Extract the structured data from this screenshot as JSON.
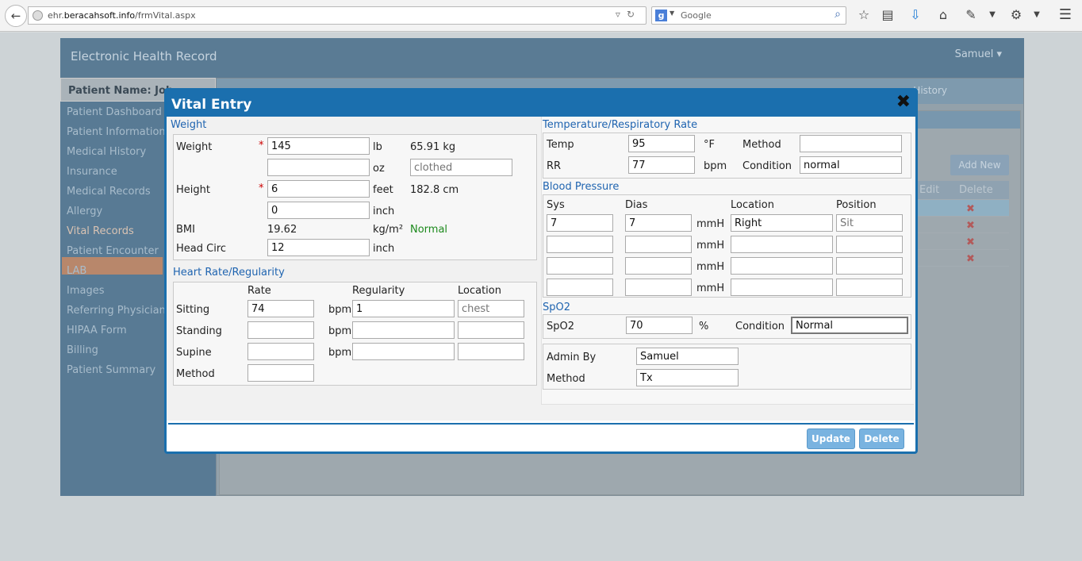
{
  "browser": {
    "url_host_pre": "ehr.",
    "url_host": "beracahsoft.info",
    "url_path": "/frmVital.aspx",
    "search_placeholder": "Google"
  },
  "app": {
    "title": "Electronic Health Record",
    "user": "Samuel",
    "patient_label": "Patient Name: Joh",
    "nav_history": "ng History",
    "add_new": "Add New",
    "table_headers": [
      "Edit",
      "Delete"
    ],
    "sidebar": [
      "Patient Dashboard",
      "Patient Information",
      "Medical History",
      "Insurance",
      "Medical Records",
      "Allergy",
      "Vital Records",
      "Patient Encounter",
      "LAB",
      "Images",
      "Referring Physician",
      "HIPAA Form",
      "Billing",
      "Patient Summary"
    ],
    "active_sidebar_item": "Vital Records"
  },
  "modal": {
    "title": "Vital Entry",
    "close": "✖",
    "weight": {
      "section": "Weight",
      "weight_label": "Weight",
      "weight_value": "145",
      "weight_unit": "lb",
      "weight_kg": "65.91 kg",
      "oz_value": "",
      "oz_unit": "oz",
      "clothed_placeholder": "clothed",
      "height_label": "Height",
      "height_feet": "6",
      "feet_unit": "feet",
      "height_cm": "182.8 cm",
      "height_inch": "0",
      "inch_unit": "inch",
      "bmi_label": "BMI",
      "bmi_value": "19.62",
      "bmi_unit": "kg/m²",
      "bmi_status": "Normal",
      "head_label": "Head Circ",
      "head_value": "12",
      "head_unit": "inch",
      "required_mark": "*"
    },
    "heart": {
      "section": "Heart Rate/Regularity",
      "col_rate": "Rate",
      "col_regularity": "Regularity",
      "col_location": "Location",
      "rows": [
        {
          "label": "Sitting",
          "rate": "74",
          "unit": "bpm",
          "regularity": "1",
          "location": "",
          "location_placeholder": "chest"
        },
        {
          "label": "Standing",
          "rate": "",
          "unit": "bpm",
          "regularity": "",
          "location": "",
          "location_placeholder": ""
        },
        {
          "label": "Supine",
          "rate": "",
          "unit": "bpm",
          "regularity": "",
          "location": "",
          "location_placeholder": ""
        }
      ],
      "method_label": "Method",
      "method_value": ""
    },
    "temp": {
      "section": "Temperature/Respiratory Rate",
      "temp_label": "Temp",
      "temp_value": "95",
      "temp_unit": "°F",
      "method_label": "Method",
      "method_value": "",
      "rr_label": "RR",
      "rr_value": "77",
      "rr_unit": "bpm",
      "condition_label": "Condition",
      "condition_value": "normal"
    },
    "bp": {
      "section": "Blood Pressure",
      "col_sys": "Sys",
      "col_dias": "Dias",
      "col_location": "Location",
      "col_position": "Position",
      "rows": [
        {
          "sys": "7",
          "dias": "7",
          "unit": "mmH",
          "location": "Right",
          "position": "",
          "position_placeholder": "Sit"
        },
        {
          "sys": "",
          "dias": "",
          "unit": "mmH",
          "location": "",
          "position": "",
          "position_placeholder": ""
        },
        {
          "sys": "",
          "dias": "",
          "unit": "mmH",
          "location": "",
          "position": "",
          "position_placeholder": ""
        },
        {
          "sys": "",
          "dias": "",
          "unit": "mmH",
          "location": "",
          "position": "",
          "position_placeholder": ""
        }
      ]
    },
    "spo2": {
      "section": "SpO2",
      "label": "SpO2",
      "value": "70",
      "unit": "%",
      "condition_label": "Condition",
      "condition_value": "Normal"
    },
    "admin": {
      "admin_label": "Admin By",
      "admin_value": "Samuel",
      "method_label": "Method",
      "method_value": "Tx"
    },
    "buttons": {
      "update": "Update",
      "delete": "Delete"
    }
  }
}
